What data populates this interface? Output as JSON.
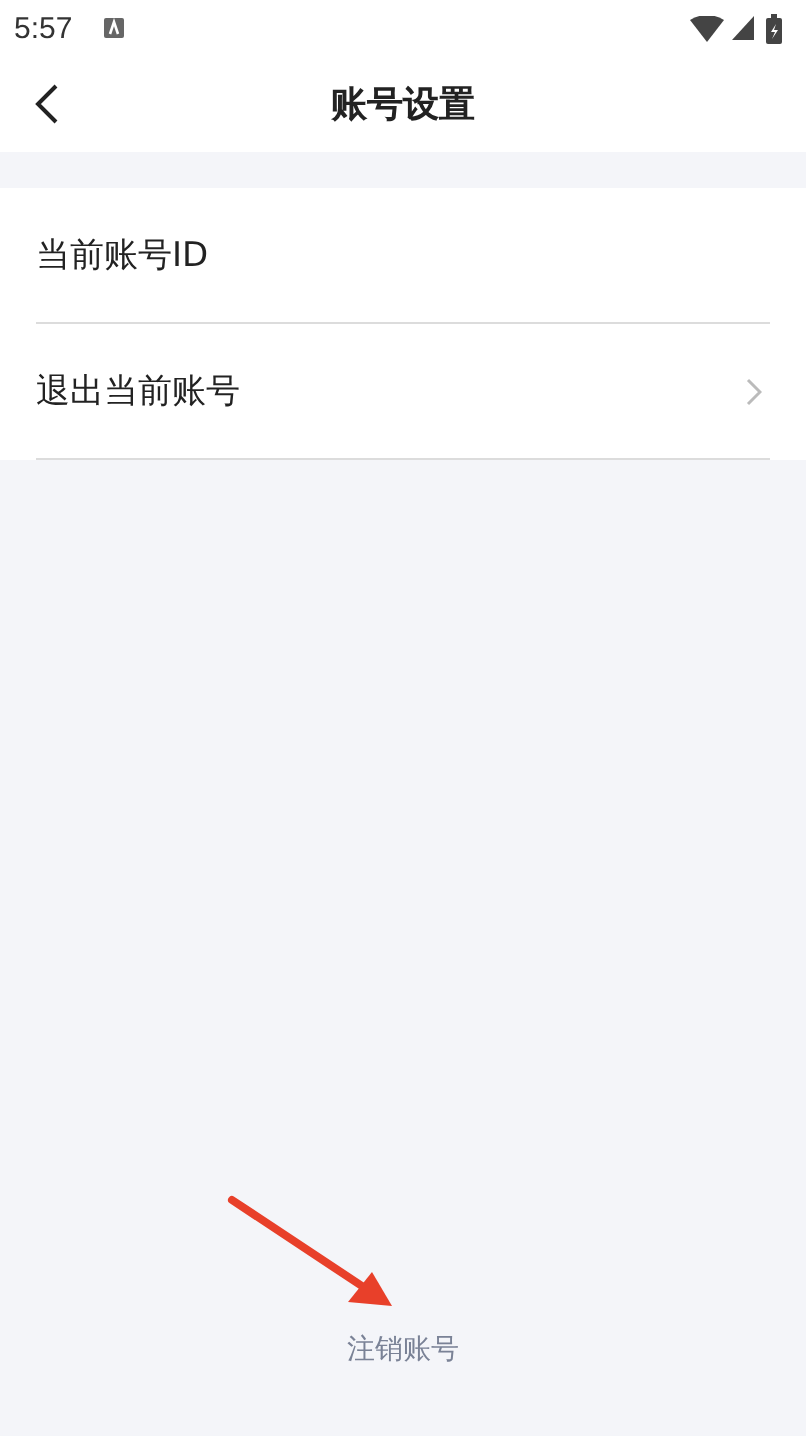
{
  "status_bar": {
    "time": "5:57"
  },
  "header": {
    "title": "账号设置"
  },
  "settings": [
    {
      "label": "当前账号ID",
      "kind": "plain"
    },
    {
      "label": "退出当前账号",
      "kind": "link"
    }
  ],
  "footer_link": "注销账号"
}
